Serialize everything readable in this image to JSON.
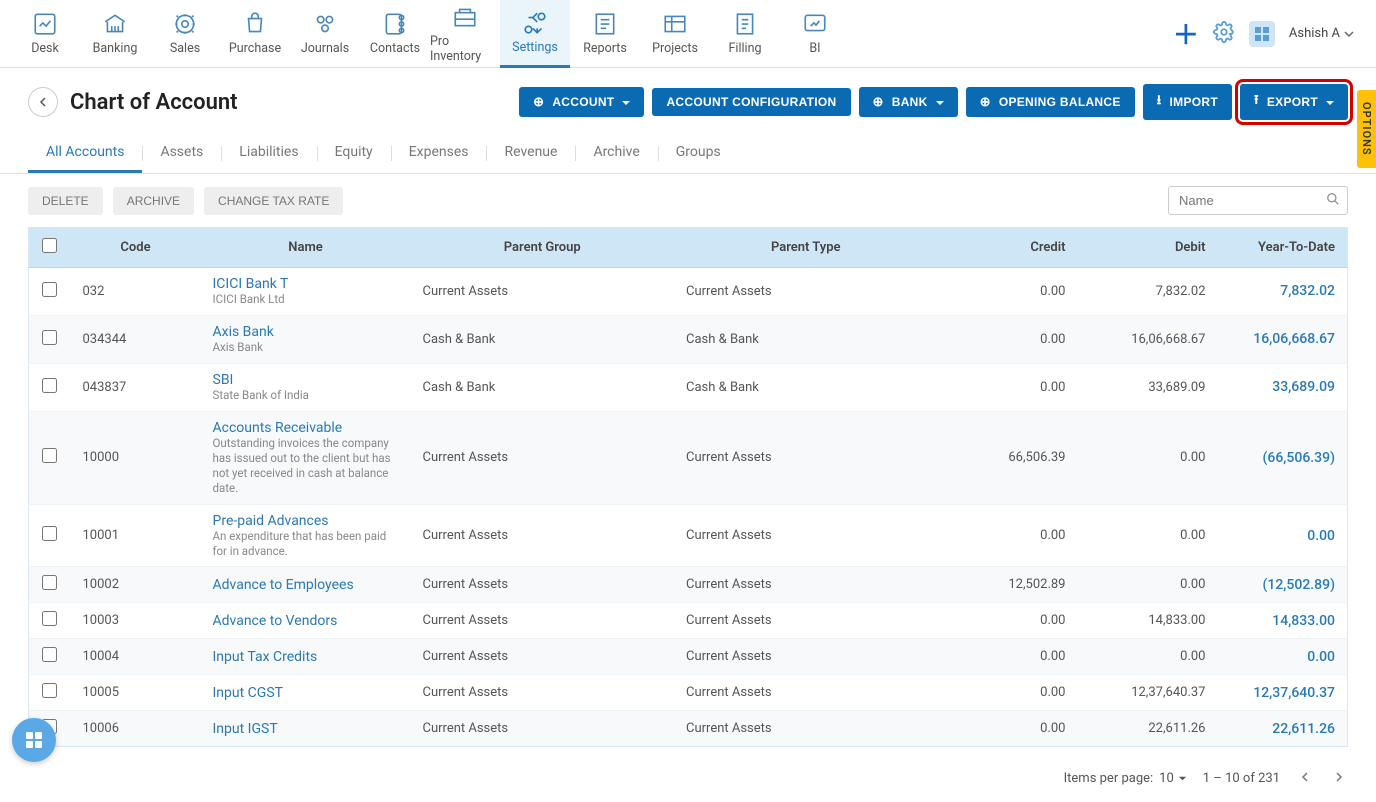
{
  "topnav": {
    "items": [
      {
        "label": "Desk"
      },
      {
        "label": "Banking"
      },
      {
        "label": "Sales"
      },
      {
        "label": "Purchase"
      },
      {
        "label": "Journals"
      },
      {
        "label": "Contacts"
      },
      {
        "label": "Pro Inventory"
      },
      {
        "label": "Settings"
      },
      {
        "label": "Reports"
      },
      {
        "label": "Projects"
      },
      {
        "label": "Filling"
      },
      {
        "label": "BI"
      }
    ],
    "user": "Ashish A"
  },
  "header": {
    "title": "Chart of Account",
    "buttons": {
      "account": "ACCOUNT",
      "account_config": "ACCOUNT CONFIGURATION",
      "bank": "BANK",
      "opening_balance": "OPENING BALANCE",
      "import": "IMPORT",
      "export": "EXPORT"
    }
  },
  "options_tab": "OPTIONS",
  "filter_tabs": [
    "All Accounts",
    "Assets",
    "Liabilities",
    "Equity",
    "Expenses",
    "Revenue",
    "Archive",
    "Groups"
  ],
  "actions": {
    "delete": "DELETE",
    "archive": "ARCHIVE",
    "change_tax": "CHANGE TAX RATE"
  },
  "search_placeholder": "Name",
  "table": {
    "headers": {
      "code": "Code",
      "name": "Name",
      "parent_group": "Parent Group",
      "parent_type": "Parent Type",
      "credit": "Credit",
      "debit": "Debit",
      "ytd": "Year-To-Date"
    },
    "rows": [
      {
        "code": "032",
        "name": "ICICI Bank T",
        "desc": "ICICI Bank Ltd",
        "pg": "Current Assets",
        "pt": "Current Assets",
        "credit": "0.00",
        "debit": "7,832.02",
        "ytd": "7,832.02"
      },
      {
        "code": "034344",
        "name": "Axis Bank",
        "desc": "Axis Bank",
        "pg": "Cash & Bank",
        "pt": "Cash & Bank",
        "credit": "0.00",
        "debit": "16,06,668.67",
        "ytd": "16,06,668.67"
      },
      {
        "code": "043837",
        "name": "SBI",
        "desc": "State Bank of India",
        "pg": "Cash & Bank",
        "pt": "Cash & Bank",
        "credit": "0.00",
        "debit": "33,689.09",
        "ytd": "33,689.09"
      },
      {
        "code": "10000",
        "name": "Accounts Receivable",
        "desc": "Outstanding invoices the company has issued out to the client but has not yet received in cash at balance date.",
        "pg": "Current Assets",
        "pt": "Current Assets",
        "credit": "66,506.39",
        "debit": "0.00",
        "ytd": "(66,506.39)"
      },
      {
        "code": "10001",
        "name": "Pre-paid Advances",
        "desc": "An expenditure that has been paid for in advance.",
        "pg": "Current Assets",
        "pt": "Current Assets",
        "credit": "0.00",
        "debit": "0.00",
        "ytd": "0.00"
      },
      {
        "code": "10002",
        "name": "Advance to Employees",
        "desc": "",
        "pg": "Current Assets",
        "pt": "Current Assets",
        "credit": "12,502.89",
        "debit": "0.00",
        "ytd": "(12,502.89)"
      },
      {
        "code": "10003",
        "name": "Advance to Vendors",
        "desc": "",
        "pg": "Current Assets",
        "pt": "Current Assets",
        "credit": "0.00",
        "debit": "14,833.00",
        "ytd": "14,833.00"
      },
      {
        "code": "10004",
        "name": "Input Tax Credits",
        "desc": "",
        "pg": "Current Assets",
        "pt": "Current Assets",
        "credit": "0.00",
        "debit": "0.00",
        "ytd": "0.00"
      },
      {
        "code": "10005",
        "name": "Input CGST",
        "desc": "",
        "pg": "Current Assets",
        "pt": "Current Assets",
        "credit": "0.00",
        "debit": "12,37,640.37",
        "ytd": "12,37,640.37"
      },
      {
        "code": "10006",
        "name": "Input IGST",
        "desc": "",
        "pg": "Current Assets",
        "pt": "Current Assets",
        "credit": "0.00",
        "debit": "22,611.26",
        "ytd": "22,611.26"
      }
    ]
  },
  "pagination": {
    "items_label": "Items per page:",
    "page_size": "10",
    "range": "1 – 10 of 231"
  }
}
